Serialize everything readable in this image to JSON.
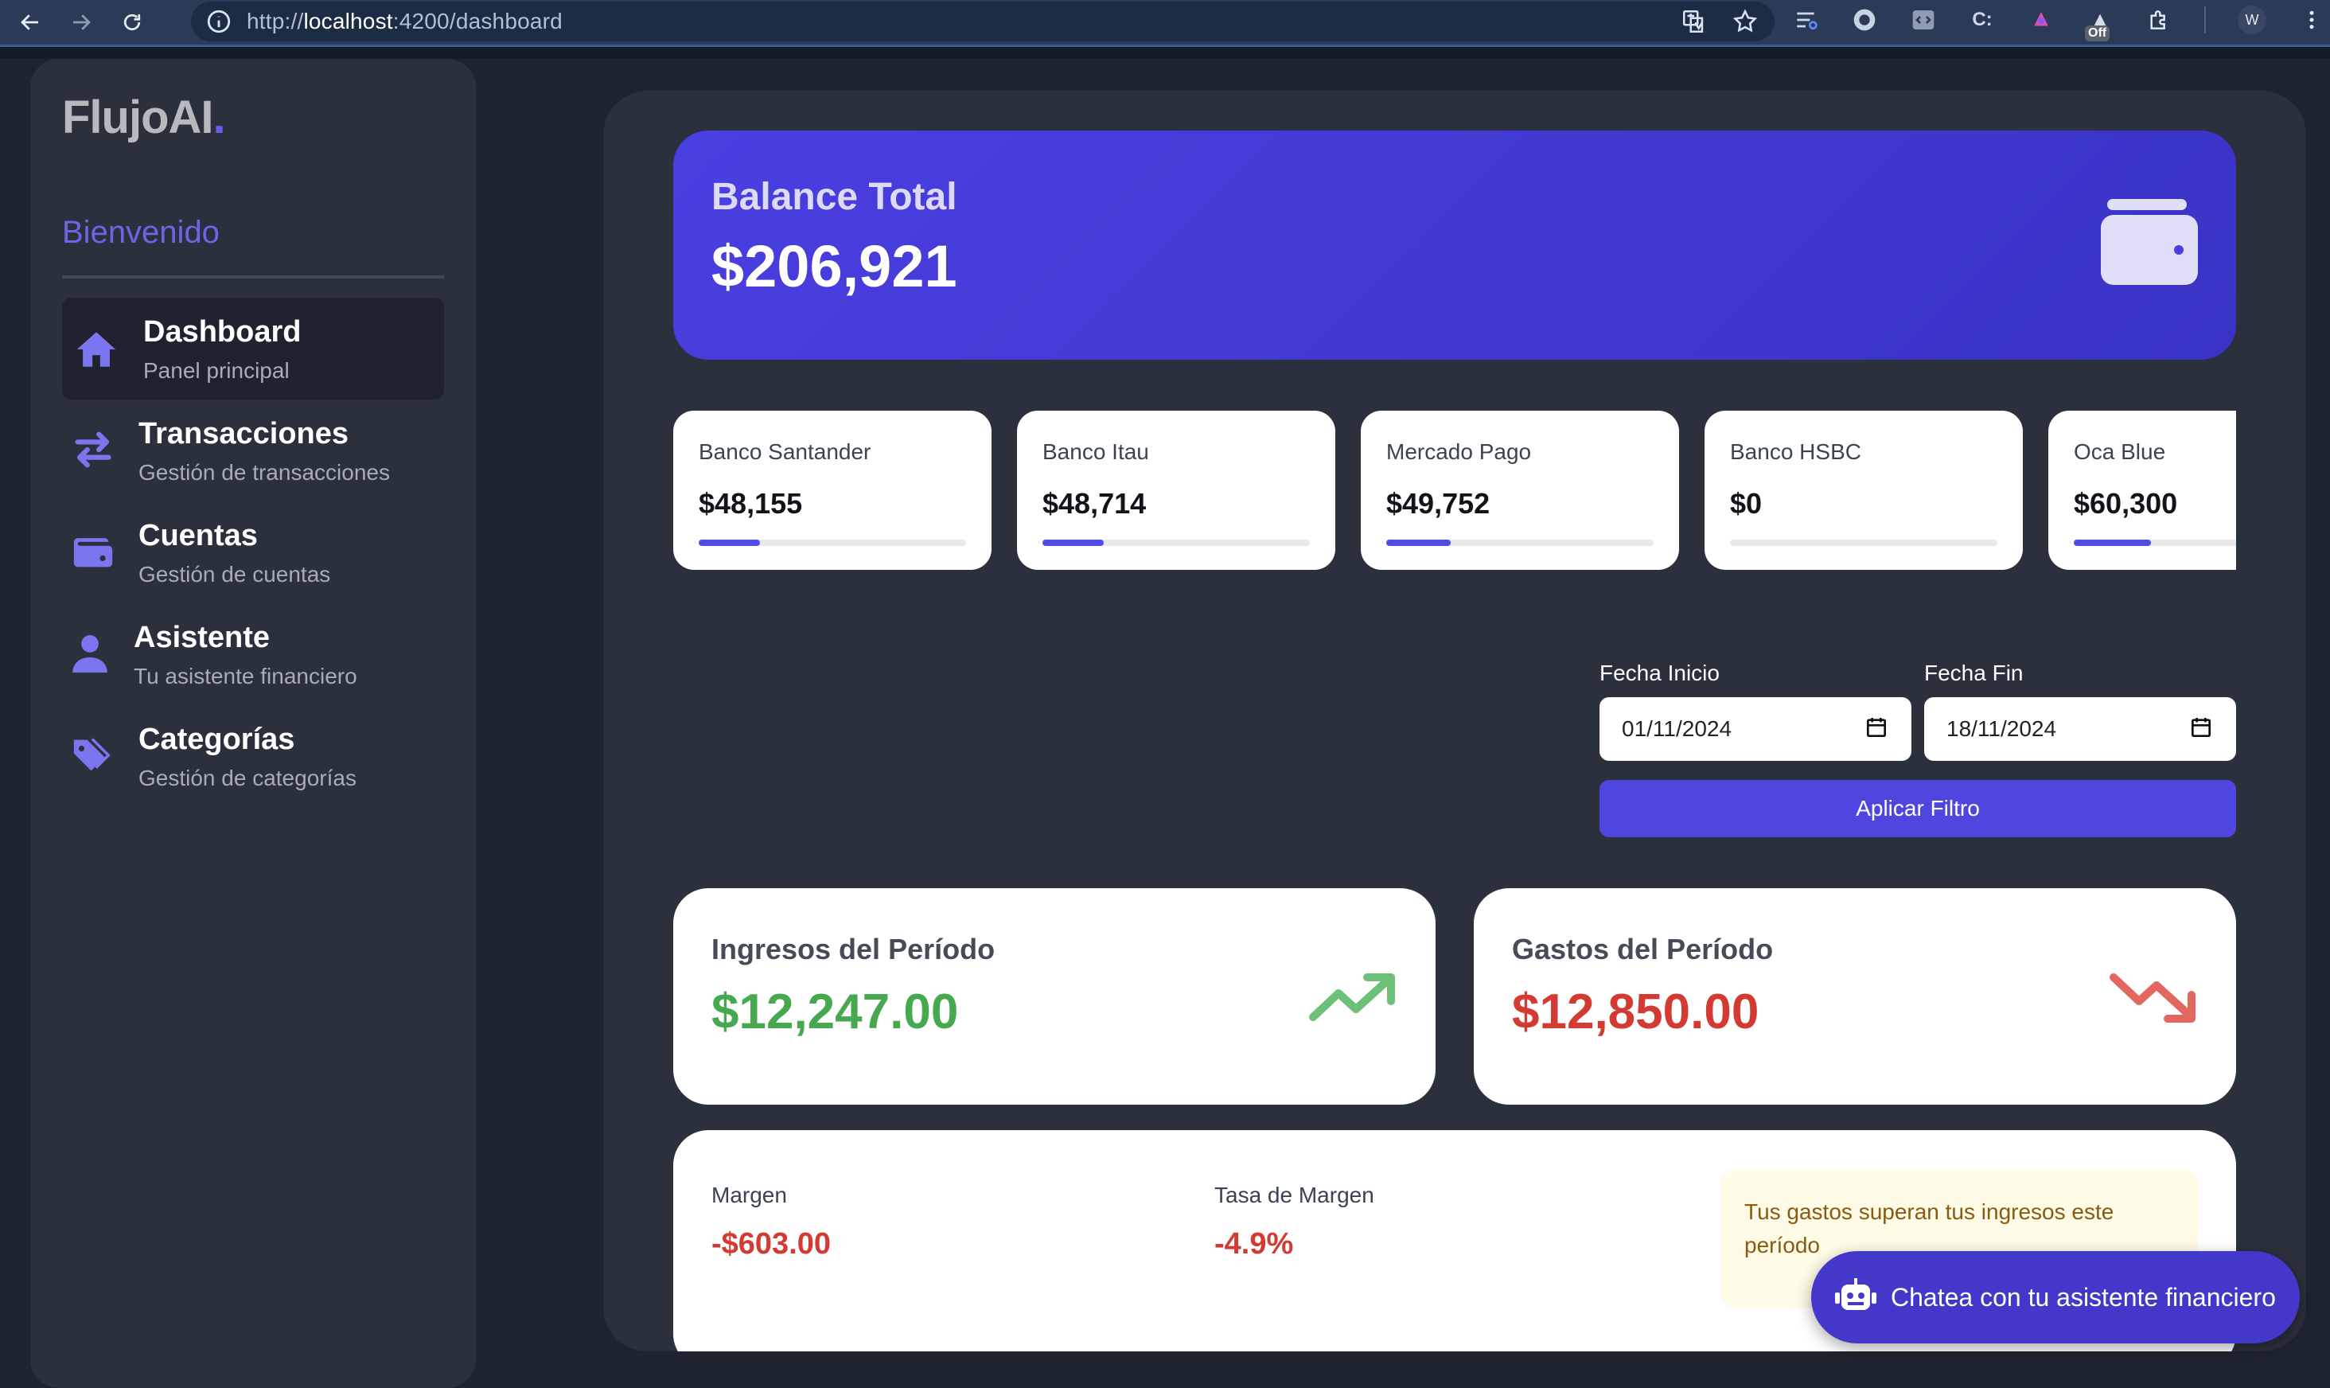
{
  "browser": {
    "url_prefix": "http://",
    "url_host": "localhost",
    "url_path": ":4200/dashboard",
    "off_badge": "Off",
    "profile_initial": "W",
    "ext_c_label": "C:"
  },
  "sidebar": {
    "logo_text": "FlujoAI",
    "logo_dot": ".",
    "welcome": "Bienvenido",
    "items": [
      {
        "title": "Dashboard",
        "subtitle": "Panel principal",
        "icon": "home-icon",
        "active": true
      },
      {
        "title": "Transacciones",
        "subtitle": "Gestión de transacciones",
        "icon": "swap-arrows-icon",
        "active": false
      },
      {
        "title": "Cuentas",
        "subtitle": "Gestión de cuentas",
        "icon": "wallet-icon",
        "active": false
      },
      {
        "title": "Asistente",
        "subtitle": "Tu asistente financiero",
        "icon": "user-icon",
        "active": false
      },
      {
        "title": "Categorías",
        "subtitle": "Gestión de categorías",
        "icon": "tags-icon",
        "active": false
      }
    ]
  },
  "balance": {
    "label": "Balance Total",
    "value": "$206,921"
  },
  "accounts": [
    {
      "name": "Banco Santander",
      "value": "$48,155",
      "progress": 0.23
    },
    {
      "name": "Banco Itau",
      "value": "$48,714",
      "progress": 0.23
    },
    {
      "name": "Mercado Pago",
      "value": "$49,752",
      "progress": 0.24
    },
    {
      "name": "Banco HSBC",
      "value": "$0",
      "progress": 0
    },
    {
      "name": "Oca Blue",
      "value": "$60,300",
      "progress": 0.29
    }
  ],
  "filter": {
    "start_label": "Fecha Inicio",
    "start_value": "01/11/2024",
    "end_label": "Fecha Fin",
    "end_value": "18/11/2024",
    "apply_label": "Aplicar Filtro"
  },
  "income": {
    "label": "Ingresos del Período",
    "value": "$12,247.00",
    "color": "#46a94f"
  },
  "expenses": {
    "label": "Gastos del Período",
    "value": "$12,850.00",
    "color": "#d23a32"
  },
  "margin": {
    "label": "Margen",
    "value": "-$603.00",
    "rate_label": "Tasa de Margen",
    "rate_value": "-4.9%",
    "warning": "Tus gastos superan tus ingresos este período"
  },
  "chat": {
    "label": "Chatea con tu asistente financiero"
  },
  "colors": {
    "accent": "#4f46e0",
    "background": "#1e2430",
    "panel": "#2b303d"
  }
}
